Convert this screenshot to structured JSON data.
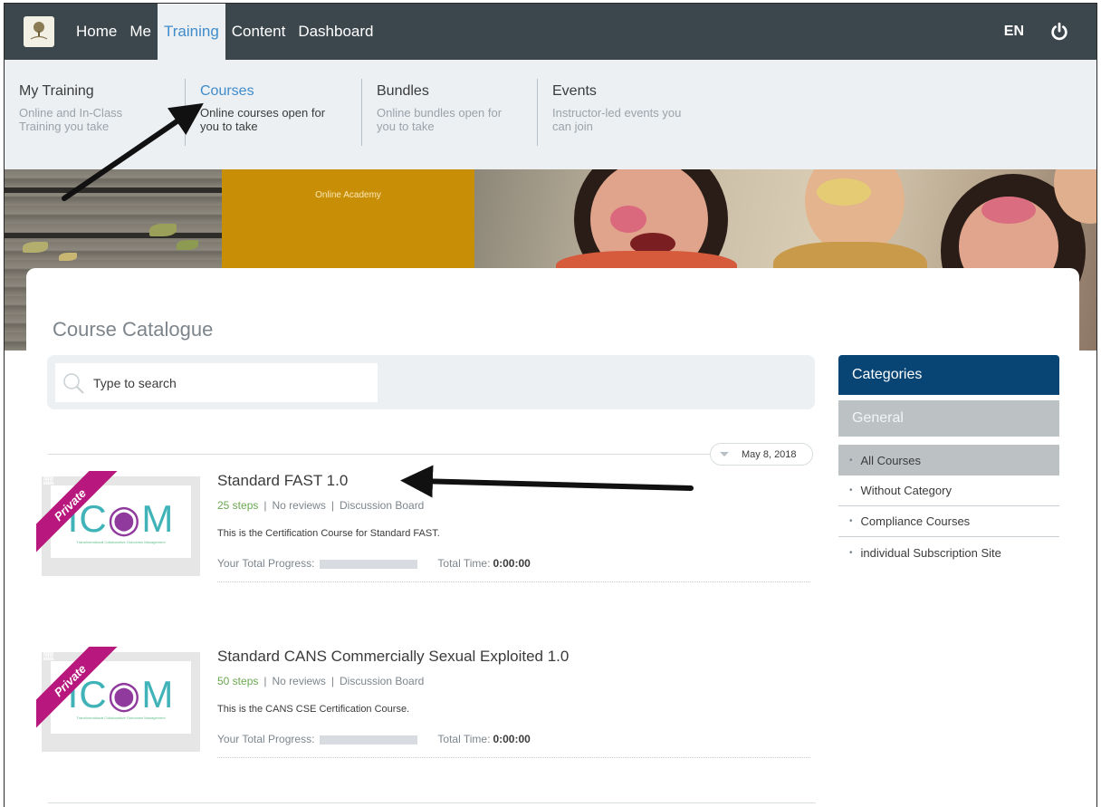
{
  "topnav": {
    "links": [
      "Home",
      "Me",
      "Training",
      "Content",
      "Dashboard"
    ],
    "active": "Training",
    "lang": "EN"
  },
  "submenu": [
    {
      "title": "My Training",
      "desc1": "Online and In-Class",
      "desc2": "Training you take"
    },
    {
      "title": "Courses",
      "desc1": "Online courses open for",
      "desc2": "you to take"
    },
    {
      "title": "Bundles",
      "desc1": "Online bundles open for",
      "desc2": "you to take"
    },
    {
      "title": "Events",
      "desc1": "Instructor-led events you",
      "desc2": "can join"
    }
  ],
  "banner": {
    "gold_text": "Online Academy"
  },
  "catalogue": {
    "title": "Course Catalogue",
    "search_placeholder": "Type to search",
    "date": "May 8, 2018"
  },
  "courses": [
    {
      "badge": "Private",
      "title": "Standard FAST 1.0",
      "steps": "25 steps",
      "reviews": "No reviews",
      "board": "Discussion Board",
      "description": "This is the Certification Course for Standard FAST.",
      "progress_label": "Your Total Progress:",
      "progress": 0,
      "time_label": "Total Time:",
      "time_value": "0:00:00"
    },
    {
      "badge": "Private",
      "title": "Standard CANS Commercially Sexual Exploited 1.0",
      "steps": "50 steps",
      "reviews": "No reviews",
      "board": "Discussion Board",
      "description": "This is the CANS CSE Certification Course.",
      "progress_label": "Your Total Progress:",
      "progress": 0,
      "time_label": "Total Time:",
      "time_value": "0:00:00"
    }
  ],
  "thumb": {
    "logo_i": "I",
    "logo_c": "C",
    "logo_m": "M",
    "logo_sub": "Transformational Collaborative Outcomes Management"
  },
  "sidebar": {
    "header": "Categories",
    "group": "General",
    "items": [
      "All Courses",
      "Without Category",
      "Compliance Courses",
      "individual Subscription Site"
    ]
  },
  "colors": {
    "nav_bg": "#3c464d",
    "accent": "#3f8ccb",
    "sidebar_header": "#084474",
    "ribbon": "#b8177e",
    "banner_gold": "#c88e06"
  }
}
